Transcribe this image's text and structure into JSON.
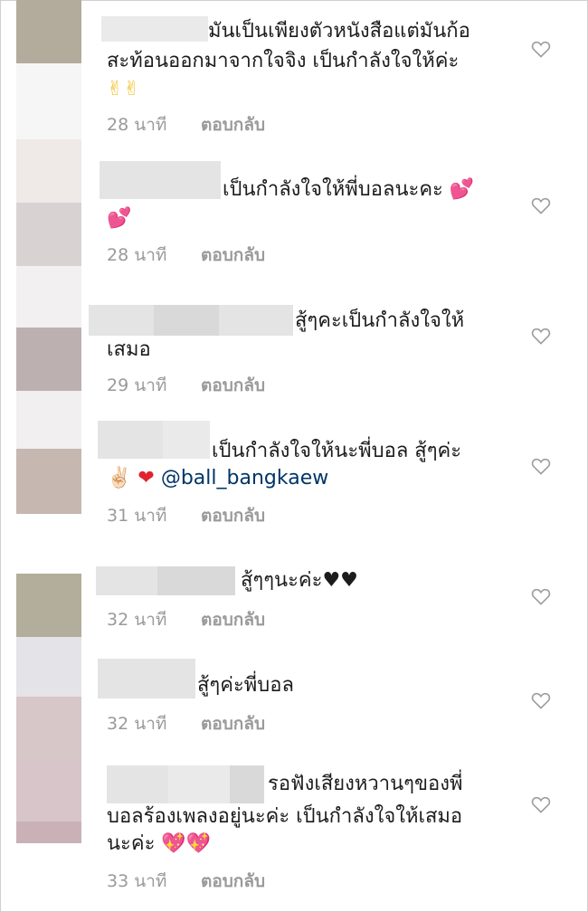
{
  "comments": [
    {
      "line1": "มันเป็นเพียงตัวหนังสือแต่มันก้อ",
      "line2": "สะท้อนออกมาจากใจจิง เป็นกำลังใจให้ค่ะ",
      "line3": "✌✌",
      "time": "28 นาที",
      "reply": "ตอบกลับ"
    },
    {
      "line1": "เป็นกำลังใจให้พี่บอลนะคะ",
      "emoji_a": "💕",
      "emoji_b": "💕",
      "time": "28 นาที",
      "reply": "ตอบกลับ"
    },
    {
      "line1": "สู้ๆคะเป็นกำลังใจให้",
      "line2": "เสมอ",
      "time": "29 นาที",
      "reply": "ตอบกลับ"
    },
    {
      "line1": "เป็นกำลังใจให้นะพี่บอล สู้ๆค่ะ",
      "emoji_peace": "✌🏻",
      "emoji_heart": "❤",
      "mention": "@ball_bangkaew",
      "time": "31 นาที",
      "reply": "ตอบกลับ"
    },
    {
      "line1": "สู้ๆๆนะค่ะ♥♥",
      "time": "32 นาที",
      "reply": "ตอบกลับ"
    },
    {
      "line1": "สู้ๆค่ะพี่บอล",
      "time": "32 นาที",
      "reply": "ตอบกลับ"
    },
    {
      "line1": "รอฟังเสียงหวานๆของพี่",
      "line2": "บอลร้องเพลงอยู่นะค่ะ  เป็นกำลังใจให้เสมอ",
      "line3": "นะค่ะ",
      "emoji_a": "💖",
      "emoji_b": "💖",
      "time": "33 นาที",
      "reply": "ตอบกลับ"
    }
  ],
  "colors": {
    "heart_outline": "#9e9e9e",
    "mention": "#003569",
    "meta_text": "#9a9a9a"
  },
  "icons": {
    "like": "heart-outline-icon"
  }
}
